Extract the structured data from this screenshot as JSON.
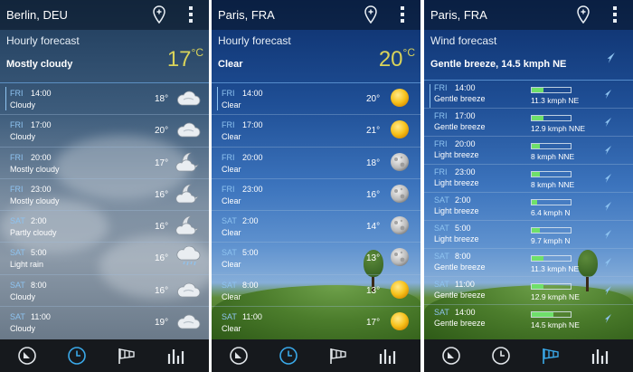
{
  "panels": [
    {
      "city": "Berlin, DEU",
      "section_title": "Hourly forecast",
      "current_condition": "Mostly cloudy",
      "current_temp": "17",
      "temp_unit": "°C",
      "rows": [
        {
          "day": "FRI",
          "time": "14:00",
          "cond": "Cloudy",
          "temp": "18°",
          "icon": "cloud-icon"
        },
        {
          "day": "FRI",
          "time": "17:00",
          "cond": "Cloudy",
          "temp": "20°",
          "icon": "cloud-icon"
        },
        {
          "day": "FRI",
          "time": "20:00",
          "cond": "Mostly cloudy",
          "temp": "17°",
          "icon": "moon-cloud-icon"
        },
        {
          "day": "FRI",
          "time": "23:00",
          "cond": "Mostly cloudy",
          "temp": "16°",
          "icon": "moon-cloud-icon"
        },
        {
          "day": "SAT",
          "time": "2:00",
          "cond": "Partly cloudy",
          "temp": "16°",
          "icon": "moon-cloud-icon"
        },
        {
          "day": "SAT",
          "time": "5:00",
          "cond": "Light rain",
          "temp": "16°",
          "icon": "rain-cloud-icon"
        },
        {
          "day": "SAT",
          "time": "8:00",
          "cond": "Cloudy",
          "temp": "16°",
          "icon": "cloud-icon"
        },
        {
          "day": "SAT",
          "time": "11:00",
          "cond": "Cloudy",
          "temp": "19°",
          "icon": "cloud-icon"
        }
      ]
    },
    {
      "city": "Paris, FRA",
      "section_title": "Hourly forecast",
      "current_condition": "Clear",
      "current_temp": "20",
      "temp_unit": "°C",
      "rows": [
        {
          "day": "FRI",
          "time": "14:00",
          "cond": "Clear",
          "temp": "20°",
          "icon": "sun-icon"
        },
        {
          "day": "FRI",
          "time": "17:00",
          "cond": "Clear",
          "temp": "21°",
          "icon": "sun-icon"
        },
        {
          "day": "FRI",
          "time": "20:00",
          "cond": "Clear",
          "temp": "18°",
          "icon": "moon-icon"
        },
        {
          "day": "FRI",
          "time": "23:00",
          "cond": "Clear",
          "temp": "16°",
          "icon": "moon-icon"
        },
        {
          "day": "SAT",
          "time": "2:00",
          "cond": "Clear",
          "temp": "14°",
          "icon": "moon-icon"
        },
        {
          "day": "SAT",
          "time": "5:00",
          "cond": "Clear",
          "temp": "13°",
          "icon": "moon-icon"
        },
        {
          "day": "SAT",
          "time": "8:00",
          "cond": "Clear",
          "temp": "13°",
          "icon": "sun-icon"
        },
        {
          "day": "SAT",
          "time": "11:00",
          "cond": "Clear",
          "temp": "17°",
          "icon": "sun-icon"
        }
      ]
    },
    {
      "city": "Paris, FRA",
      "section_title": "Wind forecast",
      "current_condition": "Gentle breeze, 14.5 kmph NE",
      "rows": [
        {
          "day": "FRI",
          "time": "14:00",
          "cond": "Gentle breeze",
          "speed": "11.3 kmph NE",
          "level": 0.3,
          "icon": "wind-arrow-icon"
        },
        {
          "day": "FRI",
          "time": "17:00",
          "cond": "Gentle breeze",
          "speed": "12.9 kmph NNE",
          "level": 0.3,
          "icon": "wind-arrow-icon"
        },
        {
          "day": "FRI",
          "time": "20:00",
          "cond": "Light breeze",
          "speed": "8 kmph NNE",
          "level": 0.2,
          "icon": "wind-arrow-icon"
        },
        {
          "day": "FRI",
          "time": "23:00",
          "cond": "Light breeze",
          "speed": "8 kmph NNE",
          "level": 0.2,
          "icon": "wind-arrow-icon"
        },
        {
          "day": "SAT",
          "time": "2:00",
          "cond": "Light breeze",
          "speed": "6.4 kmph N",
          "level": 0.15,
          "icon": "wind-arrow-icon"
        },
        {
          "day": "SAT",
          "time": "5:00",
          "cond": "Light breeze",
          "speed": "9.7 kmph N",
          "level": 0.2,
          "icon": "wind-arrow-icon"
        },
        {
          "day": "SAT",
          "time": "8:00",
          "cond": "Gentle breeze",
          "speed": "11.3 kmph NE",
          "level": 0.3,
          "icon": "wind-arrow-icon"
        },
        {
          "day": "SAT",
          "time": "11:00",
          "cond": "Gentle breeze",
          "speed": "12.9 kmph NE",
          "level": 0.3,
          "icon": "wind-arrow-icon"
        },
        {
          "day": "SAT",
          "time": "14:00",
          "cond": "Gentle breeze",
          "speed": "14.5 kmph NE",
          "level": 0.55,
          "icon": "wind-arrow-icon"
        }
      ]
    }
  ],
  "nav": {
    "items": [
      "current-icon",
      "clock-icon",
      "windsock-icon",
      "graph-icon"
    ],
    "active": [
      1,
      1,
      2
    ]
  },
  "colors": {
    "accent": "#3aa8e8",
    "day_label": "#8ec3f0",
    "big_temp": "#d9d35a",
    "wind_fill": "#6fe06a"
  }
}
